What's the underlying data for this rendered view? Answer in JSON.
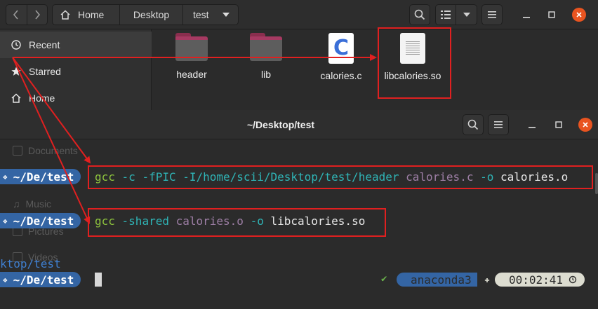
{
  "file_manager": {
    "path": [
      "Home",
      "Desktop",
      "test"
    ],
    "sidebar": [
      {
        "label": "Recent",
        "icon": "clock-icon"
      },
      {
        "label": "Starred",
        "icon": "star-icon"
      },
      {
        "label": "Home",
        "icon": "home-icon"
      }
    ],
    "files": [
      {
        "name": "header",
        "type": "folder"
      },
      {
        "name": "lib",
        "type": "folder"
      },
      {
        "name": "calories.c",
        "type": "c-source",
        "glyph": "C"
      },
      {
        "name": "libcalories.so",
        "type": "shared-library"
      }
    ]
  },
  "terminal": {
    "title": "~/Desktop/test",
    "ghost_sidebar": [
      "Documents",
      "Music",
      "Pictures",
      "Videos"
    ],
    "prompt_cwd": "~/De/test",
    "cwd_fragment": "ktop/test",
    "commands": [
      {
        "parts": [
          {
            "text": "gcc",
            "color": "green"
          },
          {
            "text": " -c -fPIC -I/home/scii/Desktop/test/header ",
            "color": "cyan"
          },
          {
            "text": "calories.c",
            "color": "purple"
          },
          {
            "text": " -o ",
            "color": "cyan"
          },
          {
            "text": "calories.o",
            "color": "white"
          }
        ]
      },
      {
        "parts": [
          {
            "text": "gcc",
            "color": "green"
          },
          {
            "text": " -shared ",
            "color": "cyan"
          },
          {
            "text": "calories.o",
            "color": "purple"
          },
          {
            "text": " -o ",
            "color": "cyan"
          },
          {
            "text": "libcalories.so",
            "color": "white"
          }
        ]
      }
    ],
    "status": {
      "ok_mark": "✔",
      "env": "anaconda3",
      "elapsed": "00:02:41"
    }
  },
  "colors": {
    "accent": "#e95420",
    "annotation": "#e02020",
    "prompt_bg": "#3465a4"
  }
}
